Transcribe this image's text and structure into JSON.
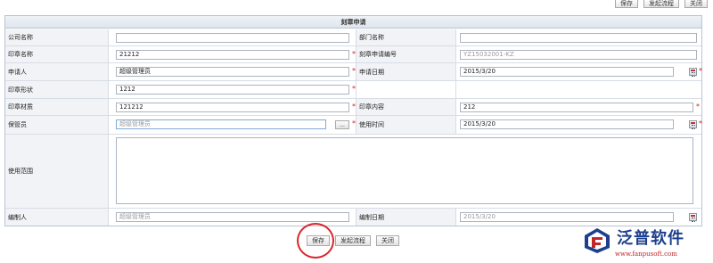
{
  "toolbar_top": {
    "save": "保存",
    "start_flow": "发起流程",
    "close": "关闭"
  },
  "form": {
    "title": "刻章申请",
    "company_label": "公司名称",
    "company_value": "",
    "dept_label": "部门名称",
    "dept_value": "",
    "seal_name_label": "印章名称",
    "seal_name_value": "21212",
    "apply_no_label": "刻章申请编号",
    "apply_no_value": "YZ15032001-KZ",
    "applicant_label": "申请人",
    "applicant_value": "超级管理员",
    "apply_date_label": "申请日期",
    "apply_date_value": "2015/3/20",
    "shape_label": "印章形状",
    "shape_value": "1212",
    "material_label": "印章材质",
    "material_value": "121212",
    "content_label": "印章内容",
    "content_value": "212",
    "keeper_label": "保管员",
    "keeper_value": "超级管理员",
    "keeper_btn": "...",
    "use_time_label": "使用时间",
    "use_time_value": "2015/3/20",
    "scope_label": "使用范围",
    "scope_value": "",
    "editor_label": "编制人",
    "editor_value": "超级管理员",
    "edit_date_label": "编制日期",
    "edit_date_value": "2015/3/20"
  },
  "bottom_bar": {
    "save": "保存",
    "start_flow": "发起流程",
    "close": "关闭"
  },
  "logo": {
    "name": "泛普软件",
    "url": "www.fanpusoft.com"
  },
  "colors": {
    "required": "#d12020",
    "highlight_circle": "#d8262d",
    "brand_blue": "#1d3f8e",
    "brand_red": "#c0262a"
  }
}
